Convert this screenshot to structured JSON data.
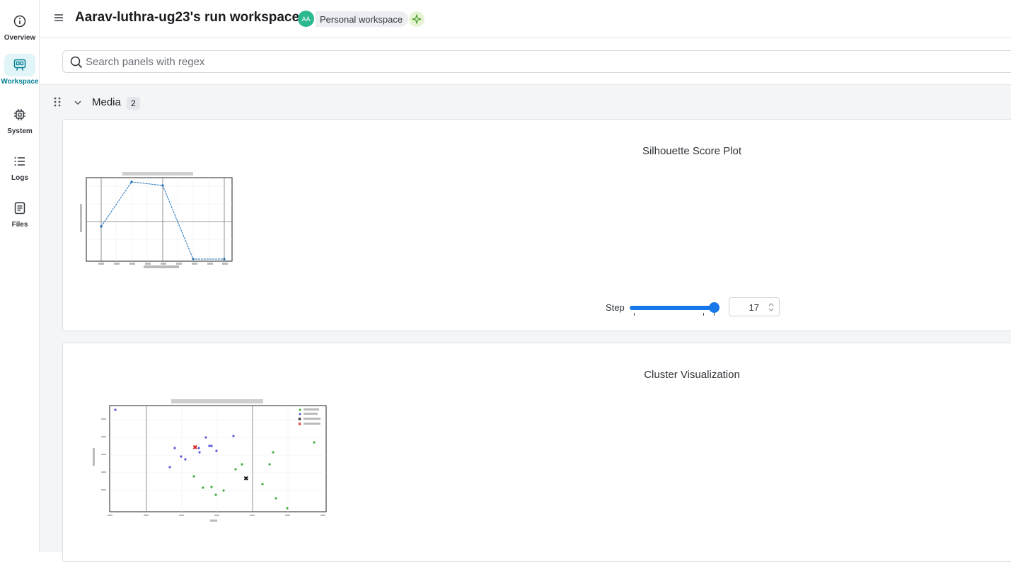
{
  "nav": {
    "items": [
      {
        "label": "Overview",
        "icon": "info-icon"
      },
      {
        "label": "Workspace",
        "icon": "workspace-icon",
        "active": true
      },
      {
        "label": "System",
        "icon": "chip-icon"
      },
      {
        "label": "Logs",
        "icon": "list-icon"
      },
      {
        "label": "Files",
        "icon": "file-icon"
      }
    ]
  },
  "header": {
    "title": "Aarav-luthra-ug23's run workspace",
    "avatar_initials": "AA",
    "workspace_label": "Personal workspace"
  },
  "search": {
    "placeholder": "Search panels with regex",
    "value": ""
  },
  "section": {
    "title": "Media",
    "count": "2"
  },
  "panels": [
    {
      "title": "Silhouette Score Plot",
      "step_label": "Step",
      "step_value": "17"
    },
    {
      "title": "Cluster Visualization"
    }
  ],
  "colors": {
    "accent": "#1677e8",
    "active_nav": "#038194",
    "avatar": "#2bb88f"
  }
}
